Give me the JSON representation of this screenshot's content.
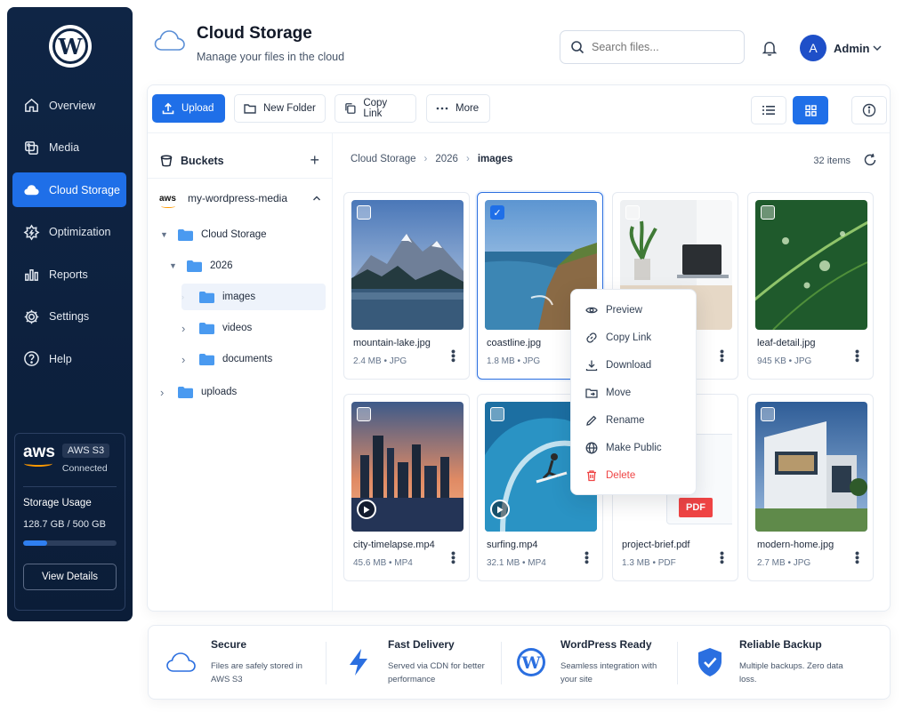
{
  "sidebar": {
    "logo": "W",
    "items": [
      {
        "label": "Overview",
        "icon": "home-icon"
      },
      {
        "label": "Media",
        "icon": "media-icon"
      },
      {
        "label": "Cloud Storage",
        "icon": "cloud-icon",
        "active": true
      },
      {
        "label": "Optimization",
        "icon": "optimization-icon"
      },
      {
        "label": "Reports",
        "icon": "reports-icon"
      },
      {
        "label": "Settings",
        "icon": "gear-icon"
      },
      {
        "label": "Help",
        "icon": "help-icon"
      }
    ],
    "aws": {
      "logo": "aws",
      "badge": "AWS S3",
      "status": "Connected",
      "usage_label": "Storage Usage",
      "usage_value": "128.7 GB / 500 GB",
      "usage_fraction": 0.257,
      "view_details": "View Details"
    }
  },
  "header": {
    "title": "Cloud Storage",
    "subtitle": "Manage your files in the cloud",
    "search_placeholder": "Search files...",
    "avatar_letter": "A",
    "user_name": "Admin"
  },
  "toolbar": {
    "upload": "Upload",
    "new_folder": "New Folder",
    "copy_link": "Copy Link",
    "more": "More"
  },
  "tree": {
    "title": "Buckets",
    "bucket_logo": "aws",
    "bucket_name": "my-wordpress-media",
    "nodes": [
      {
        "label": "Cloud Storage"
      },
      {
        "label": "2026"
      },
      {
        "label": "images"
      },
      {
        "label": "videos"
      },
      {
        "label": "documents"
      },
      {
        "label": "uploads"
      }
    ]
  },
  "breadcrumb": [
    "Cloud Storage",
    "2026",
    "images"
  ],
  "item_count": "32 items",
  "files": [
    {
      "name": "mountain-lake.jpg",
      "meta": "2.4 MB • JPG"
    },
    {
      "name": "coastline.jpg",
      "meta": "1.8 MB • JPG"
    },
    {
      "name": "",
      "meta": ""
    },
    {
      "name": "leaf-detail.jpg",
      "meta": "945 KB • JPG"
    },
    {
      "name": "city-timelapse.mp4",
      "meta": "45.6 MB • MP4"
    },
    {
      "name": "surfing.mp4",
      "meta": "32.1 MB • MP4"
    },
    {
      "name": "project-brief.pdf",
      "meta": "1.3 MB • PDF",
      "badge": "PDF"
    },
    {
      "name": "modern-home.jpg",
      "meta": "2.7 MB • JPG"
    }
  ],
  "context_menu": [
    {
      "label": "Preview",
      "icon": "eye-icon"
    },
    {
      "label": "Copy Link",
      "icon": "link-icon"
    },
    {
      "label": "Download",
      "icon": "download-icon"
    },
    {
      "label": "Move",
      "icon": "move-icon"
    },
    {
      "label": "Rename",
      "icon": "pencil-icon"
    },
    {
      "label": "Make Public",
      "icon": "globe-icon"
    },
    {
      "label": "Delete",
      "icon": "trash-icon"
    }
  ],
  "features": [
    {
      "title": "Secure",
      "desc": "Files are safely stored in AWS S3",
      "icon": "cloud-icon"
    },
    {
      "title": "Fast Delivery",
      "desc": "Served via CDN for better performance",
      "icon": "bolt-icon"
    },
    {
      "title": "WordPress Ready",
      "desc": "Seamless integration with your site",
      "icon": "wordpress-icon"
    },
    {
      "title": "Reliable Backup",
      "desc": "Multiple backups. Zero data loss.",
      "icon": "shield-check-icon"
    }
  ],
  "colors": {
    "accent": "#1f6fe8",
    "sidebar": "#0f2545",
    "danger": "#ef4444",
    "aws_orange": "#ff9900"
  }
}
